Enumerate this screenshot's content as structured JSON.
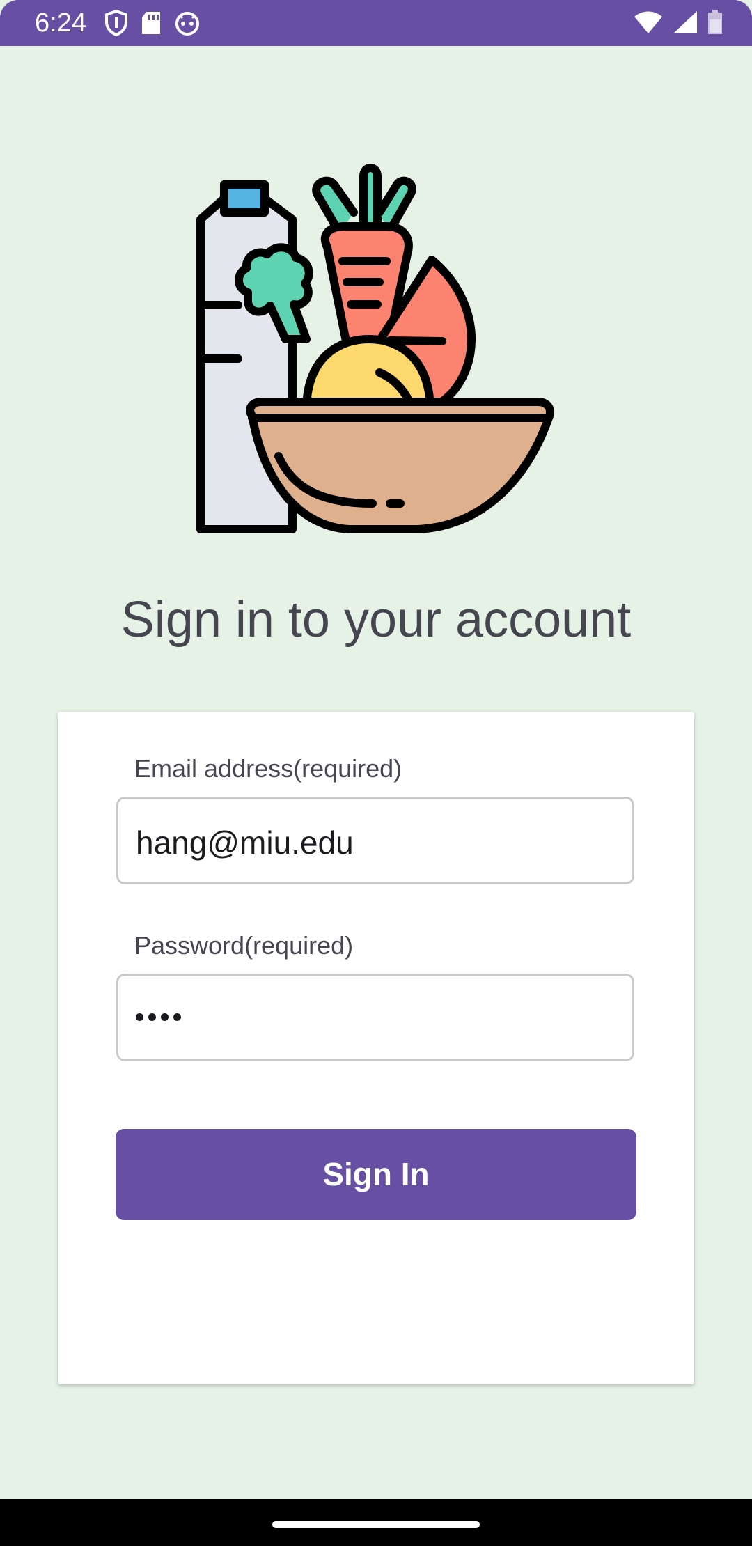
{
  "status_bar": {
    "time": "6:24",
    "left_icons": [
      "shield-icon",
      "sd-card-icon",
      "android-face-icon"
    ],
    "right_icons": [
      "wifi-icon",
      "signal-icon",
      "battery-icon"
    ]
  },
  "logo": {
    "icon": "grocery-basket-icon"
  },
  "title": "Sign in to your account",
  "form": {
    "email_label": "Email address(required)",
    "email_value": "hang@miu.edu",
    "password_label": "Password(required)",
    "password_length": 4,
    "submit_label": "Sign In"
  },
  "colors": {
    "primary": "#6750a4",
    "background": "#e6f2e6",
    "card": "#ffffff",
    "text": "#45464f",
    "field_border": "#c9c9c9"
  }
}
